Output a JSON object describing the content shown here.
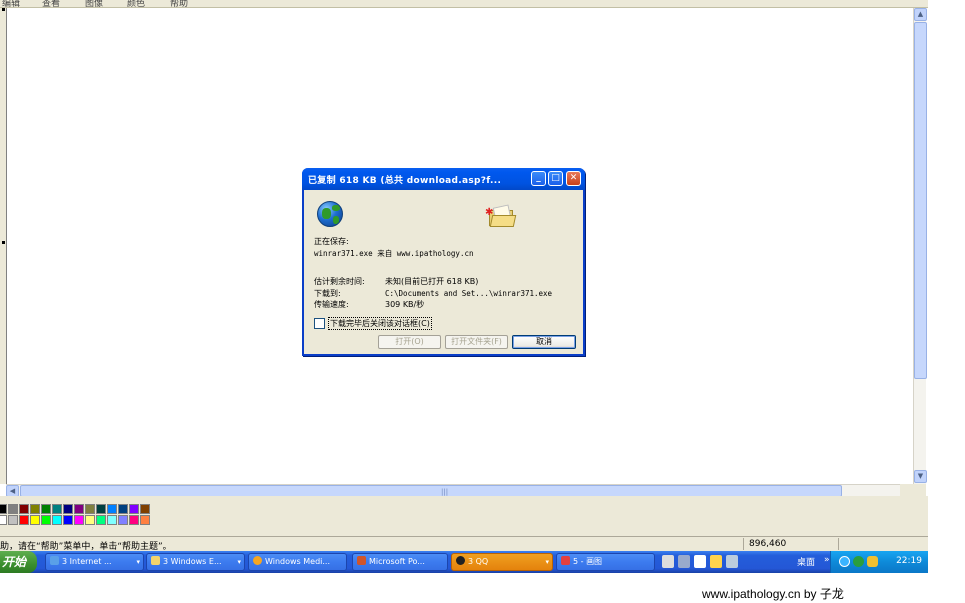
{
  "menubar": {
    "items": [
      "编辑",
      "查看",
      "图像",
      "颜色",
      "帮助"
    ]
  },
  "dialog": {
    "title": "已复制 618 KB (总共 download.asp?f...",
    "saving_label": "正在保存:",
    "saving_value": "winrar371.exe 来自 www.ipathology.cn",
    "time_label": "估计剩余时间:",
    "time_value": "未知(目前已打开 618 KB)",
    "dest_label": "下载到:",
    "dest_value": "C:\\Documents and Set...\\winrar371.exe",
    "rate_label": "传输速度:",
    "rate_value": "309 KB/秒",
    "checkbox_label": "下载完毕后关闭该对话框(C)",
    "checkbox_checked": false,
    "open_button": "打开(O)",
    "open_folder_button": "打开文件夹(F)",
    "cancel_button": "取消"
  },
  "statusbar": {
    "message": "助，请在“帮助”菜单中，单击“帮助主题”。",
    "coords": "896,460"
  },
  "palette": {
    "row1": [
      "#000000",
      "#808080",
      "#800000",
      "#808000",
      "#008000",
      "#008080",
      "#000080",
      "#800080",
      "#808040",
      "#004040",
      "#0080ff",
      "#004080",
      "#8000ff",
      "#804000"
    ],
    "row2": [
      "#ffffff",
      "#c0c0c0",
      "#ff0000",
      "#ffff00",
      "#00ff00",
      "#00ffff",
      "#0000ff",
      "#ff00ff",
      "#ffff80",
      "#00ff80",
      "#80ffff",
      "#8080ff",
      "#ff0080",
      "#ff8040"
    ]
  },
  "taskbar": {
    "start_label": "开始",
    "tasks": [
      {
        "label": "3 Internet ...",
        "icon": "ie-icon"
      },
      {
        "label": "3 Windows E...",
        "icon": "folder-icon"
      },
      {
        "label": "Windows Medi...",
        "icon": "media-player-icon"
      },
      {
        "label": "Microsoft Po...",
        "icon": "powerpoint-icon"
      },
      {
        "label": "3 QQ",
        "icon": "qq-icon"
      },
      {
        "label": "5 - 画图",
        "icon": "paint-icon"
      }
    ],
    "desktop_label": "桌面",
    "chevron": "»",
    "clock": "22:19"
  },
  "watermark": "www.ipathology.cn  by 子龙",
  "colors": {
    "title_blue": "#0058ee",
    "taskbar_blue": "#245edb",
    "active_task": "#e4820c",
    "dialog_bg": "#ece9d8"
  }
}
